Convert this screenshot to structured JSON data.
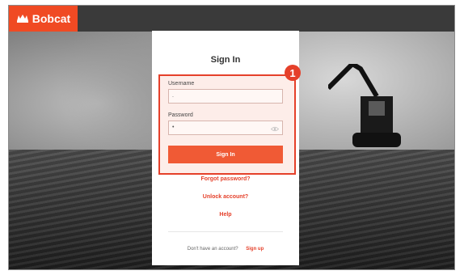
{
  "header": {
    "brand": "Bobcat"
  },
  "form": {
    "title": "Sign In",
    "username_label": "Username",
    "username_value": ".",
    "password_label": "Password",
    "password_value": "•",
    "signin_button": "Sign In",
    "forgot_password": "Forgot password?",
    "unlock_account": "Unlock account?",
    "help": "Help",
    "no_account_text": "Don't have an account?",
    "signup_link": "Sign up"
  },
  "annotation": {
    "badge_number": "1"
  },
  "colors": {
    "brand": "#f04a23",
    "accent": "#e5402a",
    "button": "#f05a35"
  },
  "icons": {
    "logo": "bobcat-logo-icon",
    "password_toggle": "eye-icon"
  }
}
